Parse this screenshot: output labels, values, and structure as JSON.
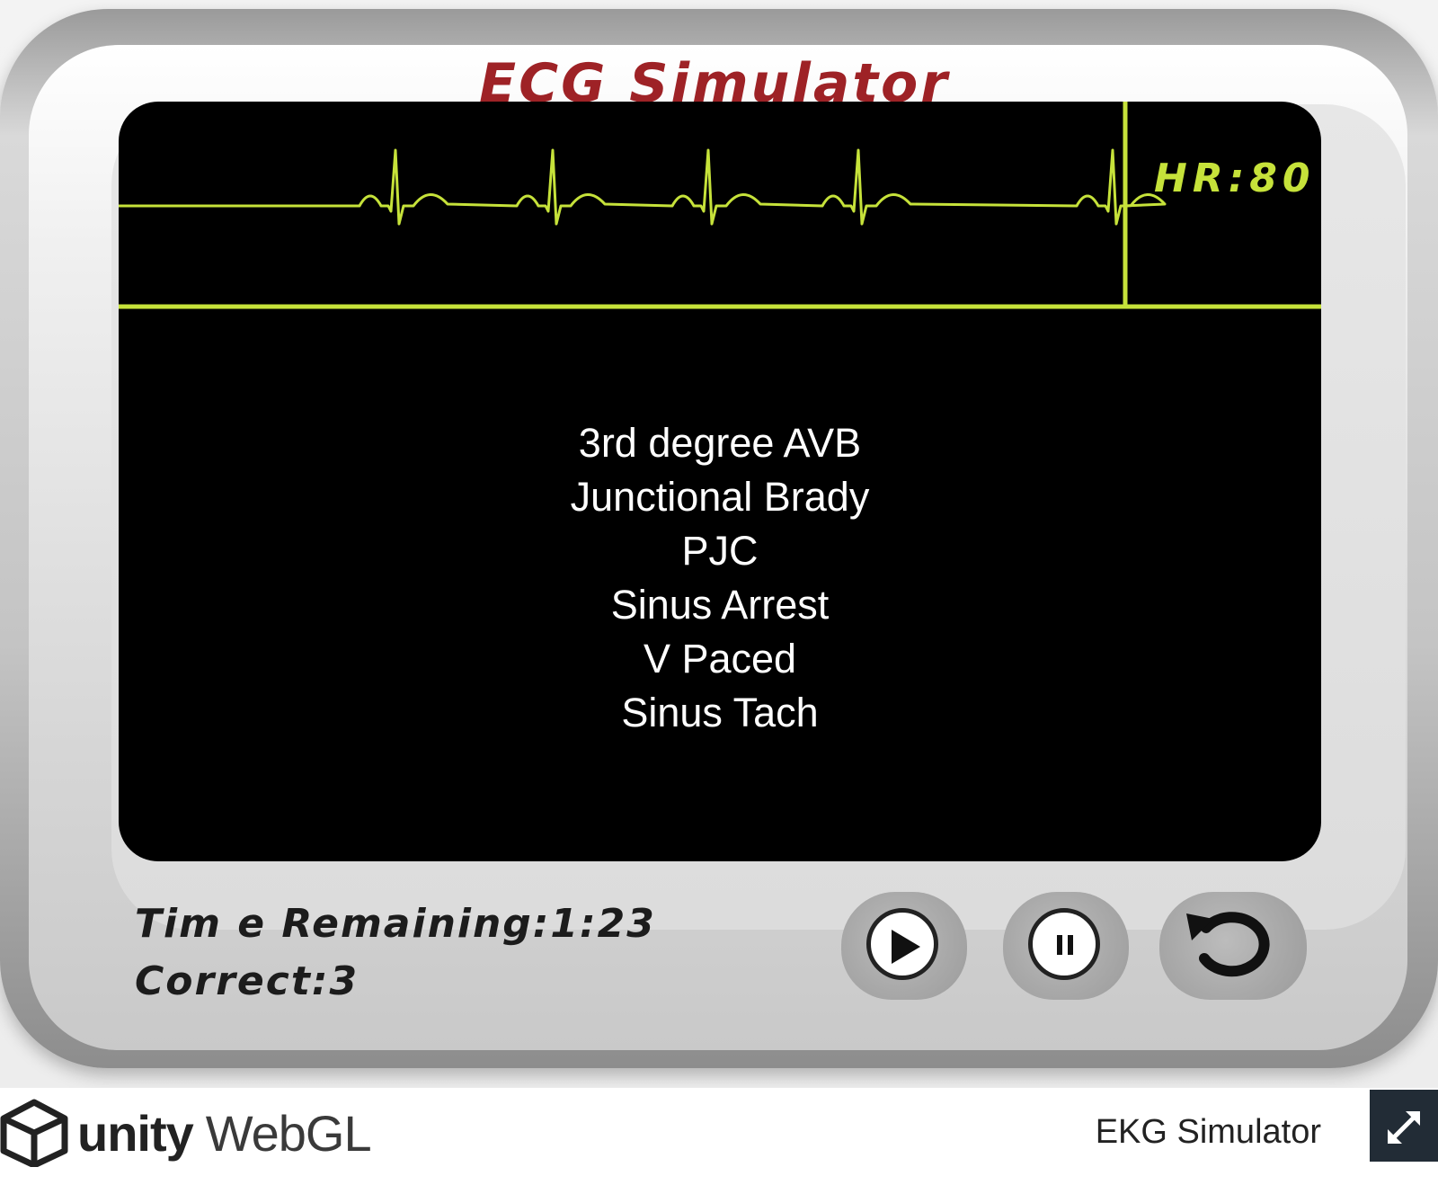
{
  "app": {
    "title": "ECG Simulator"
  },
  "monitor": {
    "heart_rate_label": "HR:80",
    "trace_color": "#c6e23a",
    "rhythm_options": [
      "3rd degree AVB",
      "Junctional Brady",
      "PJC",
      "Sinus Arrest",
      "V Paced",
      "Sinus Tach"
    ]
  },
  "status": {
    "time_remaining_label": "Tim e Remaining:",
    "time_remaining_value": "1:23",
    "correct_label": "Correct:",
    "correct_value": "3"
  },
  "controls": {
    "play_icon": "play-icon",
    "pause_icon": "pause-icon",
    "reset_icon": "reset-icon"
  },
  "footer": {
    "brand_unity": "unity",
    "brand_webgl": "WebGL",
    "build_title": "EKG Simulator",
    "fullscreen_icon": "fullscreen-icon"
  }
}
